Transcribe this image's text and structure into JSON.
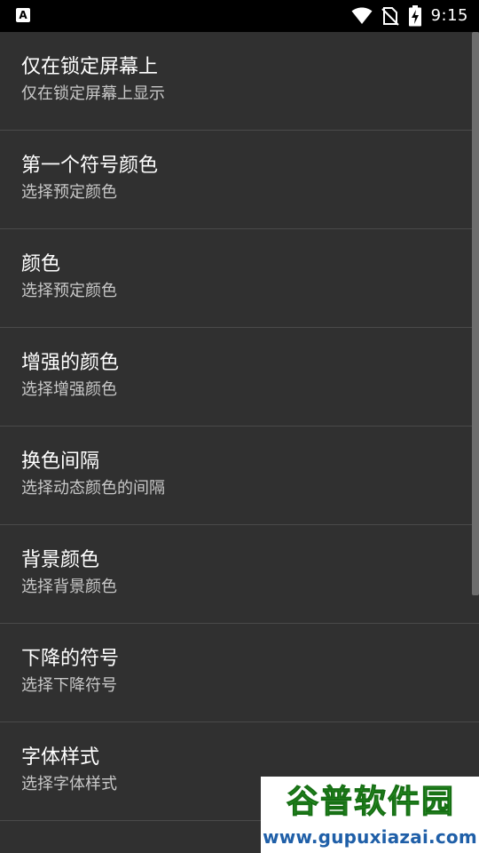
{
  "status_bar": {
    "app_badge": "A",
    "time": "9:15",
    "icons": [
      "wifi-icon",
      "no-sim-icon",
      "battery-charging-icon"
    ]
  },
  "settings": {
    "items": [
      {
        "title": "仅在锁定屏幕上",
        "summary": "仅在锁定屏幕上显示"
      },
      {
        "title": "第一个符号颜色",
        "summary": "选择预定颜色"
      },
      {
        "title": "颜色",
        "summary": "选择预定颜色"
      },
      {
        "title": "增强的颜色",
        "summary": "选择增强颜色"
      },
      {
        "title": "换色间隔",
        "summary": "选择动态颜色的间隔"
      },
      {
        "title": "背景颜色",
        "summary": "选择背景颜色"
      },
      {
        "title": "下降的符号",
        "summary": "选择下降符号"
      },
      {
        "title": "字体样式",
        "summary": "选择字体样式"
      }
    ]
  },
  "watermark": {
    "title": "谷普软件园",
    "url": "www.gupuxiazai.com"
  },
  "colors": {
    "background": "#303030",
    "statusbar": "#000000",
    "divider": "#4a4a4a",
    "summary_text": "#c8c8c8"
  }
}
